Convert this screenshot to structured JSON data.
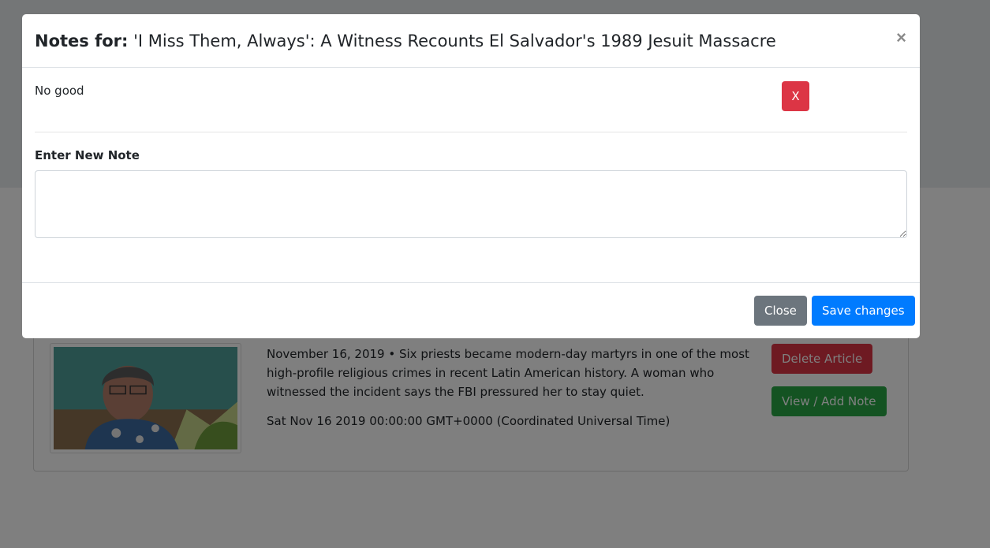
{
  "background": {
    "article": {
      "summary": "November 16, 2019 • Six priests became modern-day martyrs in one of the most high-profile religious crimes in recent Latin American history. A woman who witnessed the incident says the FBI pressured her to stay quiet.",
      "date": "Sat Nov 16 2019 00:00:00 GMT+0000 (Coordinated Universal Time)",
      "delete_label": "Delete Article",
      "view_note_label": "View / Add Note"
    }
  },
  "modal": {
    "title_prefix": "Notes for:",
    "title_article": "'I Miss Them, Always': A Witness Recounts El Salvador's 1989 Jesuit Massacre",
    "close_icon": "×",
    "notes": [
      {
        "text": "No good",
        "delete_label": "X"
      }
    ],
    "new_note_label": "Enter New Note",
    "textarea_value": "",
    "footer": {
      "close_label": "Close",
      "save_label": "Save changes"
    }
  },
  "colors": {
    "danger": "#dc3545",
    "success": "#28a745",
    "secondary": "#6c757d",
    "primary": "#007bff"
  }
}
